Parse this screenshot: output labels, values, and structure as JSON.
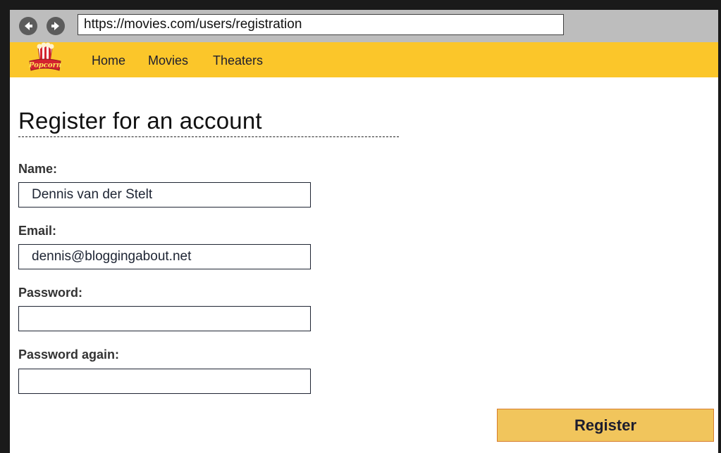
{
  "browser": {
    "url": "https://movies.com/users/registration",
    "back_icon": "back-arrow-icon",
    "forward_icon": "forward-arrow-icon"
  },
  "header": {
    "logo_text": "Popcorn",
    "nav": [
      {
        "label": "Home"
      },
      {
        "label": "Movies"
      },
      {
        "label": "Theaters"
      }
    ]
  },
  "form": {
    "title": "Register for an account",
    "name_label": "Name:",
    "name_value": "Dennis van der Stelt",
    "email_label": "Email:",
    "email_value": "dennis@bloggingabout.net",
    "password_label": "Password:",
    "password_value": "",
    "password_again_label": "Password again:",
    "password_again_value": "",
    "submit_label": "Register"
  },
  "colors": {
    "header_bg": "#fbc62a",
    "button_bg": "#f1c55c",
    "button_border": "#d77d2c"
  }
}
